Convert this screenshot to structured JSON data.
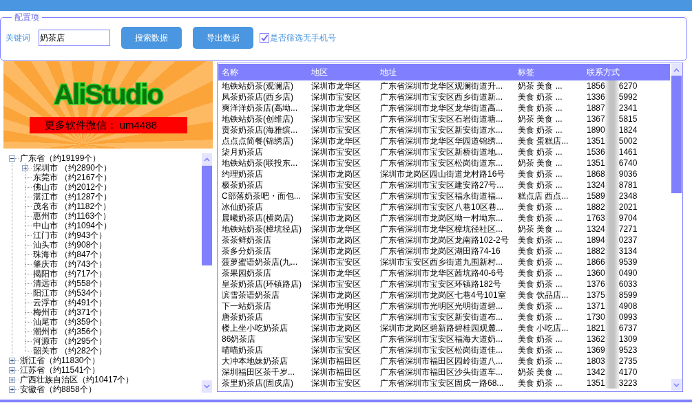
{
  "config": {
    "title": "配置项",
    "keyword": {
      "label": "关键词",
      "value": "奶茶店"
    },
    "buttons": [
      "搜索数据",
      "导出数据"
    ],
    "filter_no_phone": {
      "label": "是否筛选无手机号",
      "checked": true
    }
  },
  "banner": {
    "logo": "AliStudio",
    "contact": "更多软件微信： um4488"
  },
  "tree": [
    {
      "label": "广东省（约19199个）",
      "kind": "group",
      "expanded": true,
      "children": [
        {
          "label": "深圳市 （约2890个）",
          "kind": "group",
          "expanded": false
        },
        {
          "label": "东莞市 （约2167个）",
          "kind": "leaf"
        },
        {
          "label": "佛山市 （约2012个）",
          "kind": "leaf"
        },
        {
          "label": "湛江市 （约1287个）",
          "kind": "leaf"
        },
        {
          "label": "茂名市 （约1182个）",
          "kind": "leaf"
        },
        {
          "label": "惠州市 （约1163个）",
          "kind": "leaf"
        },
        {
          "label": "中山市 （约1094个）",
          "kind": "leaf"
        },
        {
          "label": "江门市 （约943个）",
          "kind": "leaf"
        },
        {
          "label": "汕头市 （约908个）",
          "kind": "leaf"
        },
        {
          "label": "珠海市 （约847个）",
          "kind": "leaf"
        },
        {
          "label": "肇庆市 （约743个）",
          "kind": "leaf"
        },
        {
          "label": "揭阳市 （约717个）",
          "kind": "leaf"
        },
        {
          "label": "清远市 （约558个）",
          "kind": "leaf"
        },
        {
          "label": "阳江市 （约534个）",
          "kind": "leaf"
        },
        {
          "label": "云浮市 （约491个）",
          "kind": "leaf"
        },
        {
          "label": "梅州市 （约371个）",
          "kind": "leaf"
        },
        {
          "label": "汕尾市 （约359个）",
          "kind": "leaf"
        },
        {
          "label": "潮州市 （约356个）",
          "kind": "leaf"
        },
        {
          "label": "河源市 （约295个）",
          "kind": "leaf"
        },
        {
          "label": "韶关市 （约282个）",
          "kind": "leaf"
        }
      ]
    },
    {
      "label": "浙江省（约11830个）",
      "kind": "group",
      "expanded": false
    },
    {
      "label": "江苏省（约11541个）",
      "kind": "group",
      "expanded": false
    },
    {
      "label": "广西壮族自治区（约10417个）",
      "kind": "group",
      "expanded": false
    },
    {
      "label": "安徽省（约8858个）",
      "kind": "group",
      "expanded": false
    }
  ],
  "table": {
    "columns": [
      "名称",
      "地区",
      "地址",
      "标签",
      "联系方式"
    ],
    "rows": [
      {
        "name": "地铁站奶茶(观澜店)",
        "region": "深圳市龙华区",
        "address": "广东省深圳市龙华区观澜街道升...",
        "tags": "奶茶 美食 ...",
        "phone_start": "1856",
        "phone_end": "6270"
      },
      {
        "name": "凤茶奶茶店(西乡店)",
        "region": "深圳市宝安区",
        "address": "广东省深圳市宝安区西乡街道新...",
        "tags": "美食 奶茶 ...",
        "phone_start": "1336",
        "phone_end": "5992"
      },
      {
        "name": "爽洋洋奶茶店(高坳...",
        "region": "深圳市龙华区",
        "address": "广东省深圳市龙华区龙华街道高...",
        "tags": "美食 奶茶 ...",
        "phone_start": "1887",
        "phone_end": "2341"
      },
      {
        "name": "地铁站奶茶(创维店)",
        "region": "深圳市宝安区",
        "address": "广东省深圳市宝安区石岩街道塘...",
        "tags": "奶茶 美食 ...",
        "phone_start": "1367",
        "phone_end": "5815"
      },
      {
        "name": "贡茶奶茶店(海雅缤...",
        "region": "深圳市宝安区",
        "address": "广东省深圳市宝安区新安街道水...",
        "tags": "美食 奶茶 ...",
        "phone_start": "1890",
        "phone_end": "1824"
      },
      {
        "name": "点点点简餐(锦绣店)",
        "region": "深圳市龙华区",
        "address": "广东省深圳市龙华区华园道锦绣...",
        "tags": "美食 蛋糕店...",
        "phone_start": "1351",
        "phone_end": "5002"
      },
      {
        "name": "柒月奶茶店",
        "region": "深圳市宝安区",
        "address": "广东省深圳市宝安区新桥街道地...",
        "tags": "美食 奶茶 ...",
        "phone_start": "1536",
        "phone_end": "1461"
      },
      {
        "name": "地铁站奶茶(联投东...",
        "region": "深圳市宝安区",
        "address": "广东省深圳市宝安区松岗街道东...",
        "tags": "奶茶 美食 ...",
        "phone_start": "1351",
        "phone_end": "6740"
      },
      {
        "name": "约理奶茶店",
        "region": "深圳市龙岗区",
        "address": "深圳市龙岗区园山街道龙村路16号",
        "tags": "美食 奶茶 ...",
        "phone_start": "1868",
        "phone_end": "9036"
      },
      {
        "name": "极茶奶茶店",
        "region": "深圳市宝安区",
        "address": "广东省深圳市宝安区建安路27号...",
        "tags": "美食 奶茶 ...",
        "phone_start": "1324",
        "phone_end": "8781"
      },
      {
        "name": "C部落奶茶吧・面包...",
        "region": "深圳市宝安区",
        "address": "广东省深圳市宝安区福永街道福...",
        "tags": "糕点店 西点...",
        "phone_start": "1589",
        "phone_end": "2348"
      },
      {
        "name": "冰仙奶茶店",
        "region": "深圳市宝安区",
        "address": "广东省深圳市宝安区八巷10区巷...",
        "tags": "美食 奶茶 ...",
        "phone_start": "1882",
        "phone_end": "2021"
      },
      {
        "name": "晨曦奶茶店(横岗店)",
        "region": "深圳市龙岗区",
        "address": "广东省深圳市龙岗区坳一村坳东...",
        "tags": "美食 奶茶 ...",
        "phone_start": "1763",
        "phone_end": "9704"
      },
      {
        "name": "地铁站奶茶(樟坑径店)",
        "region": "深圳市龙华区",
        "address": "广东省深圳市龙华区樟坑径社区...",
        "tags": "奶茶 美食 ...",
        "phone_start": "1324",
        "phone_end": "7271"
      },
      {
        "name": "茶茶鲜奶茶店",
        "region": "深圳市龙岗区",
        "address": "广东省深圳市龙岗区龙南路102-2号",
        "tags": "美食 奶茶 ...",
        "phone_start": "1894",
        "phone_end": "0237"
      },
      {
        "name": "茶多分奶茶店",
        "region": "深圳市龙岗区",
        "address": "广东省深圳市龙岗区湖田路74-16",
        "tags": "美食 奶茶 ...",
        "phone_start": "1882",
        "phone_end": "3134"
      },
      {
        "name": "菠萝蜜语奶茶店(九...",
        "region": "深圳市宝安区",
        "address": "深圳市宝安区西乡街道九围新村...",
        "tags": "美食 奶茶 ...",
        "phone_start": "1866",
        "phone_end": "9539"
      },
      {
        "name": "茶果园奶茶店",
        "region": "深圳市龙华区",
        "address": "广东省深圳市龙华区茜坑路40-6号",
        "tags": "美食 奶茶 ...",
        "phone_start": "1360",
        "phone_end": "0490"
      },
      {
        "name": "皇茶奶茶店(环镇路店)",
        "region": "深圳市宝安区",
        "address": "广东省深圳市宝安区环镇路182号",
        "tags": "美食 奶茶 ...",
        "phone_start": "1376",
        "phone_end": "6033"
      },
      {
        "name": "滨雪茶语奶茶店",
        "region": "深圳市龙岗区",
        "address": "广东省深圳市龙岗区七巷4号101室",
        "tags": "美食 饮品店...",
        "phone_start": "1375",
        "phone_end": "8599"
      },
      {
        "name": "下一站奶茶店",
        "region": "深圳市光明区",
        "address": "广东省深圳市光明区光明街道碧...",
        "tags": "美食 奶茶 ...",
        "phone_start": "1371",
        "phone_end": "4908"
      },
      {
        "name": "唐茶奶茶店",
        "region": "深圳市宝安区",
        "address": "广东省深圳市宝安区新安街道布...",
        "tags": "美食 奶茶 ...",
        "phone_start": "1730",
        "phone_end": "0993"
      },
      {
        "name": "楼上坐小吃奶茶店",
        "region": "深圳市龙岗区",
        "address": "深圳市龙岗区碧新路碧桂园观麓...",
        "tags": "美食 小吃店...",
        "phone_start": "1821",
        "phone_end": "6737"
      },
      {
        "name": "86奶茶店",
        "region": "深圳市宝安区",
        "address": "广东省深圳市宝安区福海大道奶...",
        "tags": "美食 奶茶 ...",
        "phone_start": "1362",
        "phone_end": "1309"
      },
      {
        "name": "喵喵奶茶店",
        "region": "深圳市宝安区",
        "address": "广东省深圳市宝安区松岗街道佳...",
        "tags": "美食 奶茶 ...",
        "phone_start": "1369",
        "phone_end": "9523"
      },
      {
        "name": "大冲本地妹奶茶店",
        "region": "深圳市福田区",
        "address": "广东省深圳市福田区园岭街道八...",
        "tags": "美食 奶茶 ...",
        "phone_start": "1803",
        "phone_end": "2735"
      },
      {
        "name": "深圳福田区茶千岁...",
        "region": "深圳市福田区",
        "address": "广东省深圳市福田区沙头街道车...",
        "tags": "奶茶 美食 ...",
        "phone_start": "1342",
        "phone_end": "4170"
      },
      {
        "name": "茶里奶茶店(固戍店)",
        "region": "深圳市宝安区",
        "address": "广东省深圳市宝安区固戍一路68...",
        "tags": "美食 奶茶 ...",
        "phone_start": "1351",
        "phone_end": "3223"
      }
    ]
  }
}
